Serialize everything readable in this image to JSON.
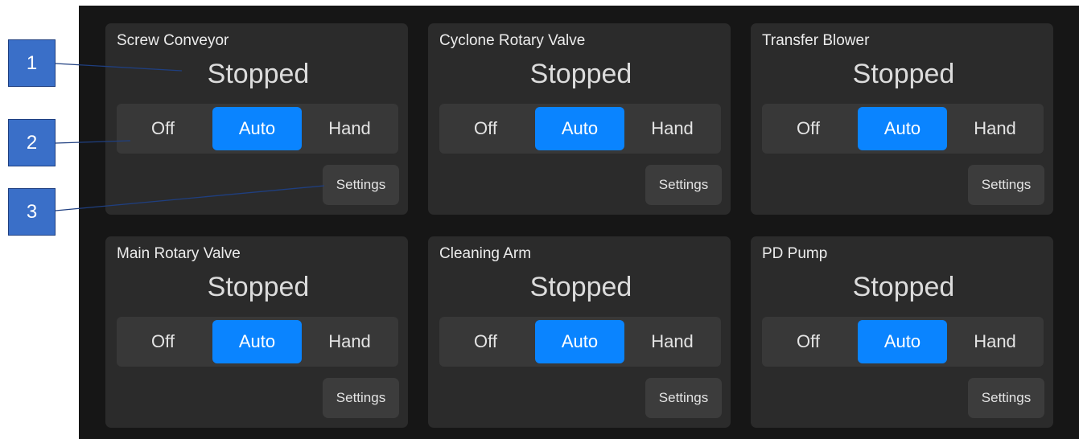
{
  "callouts": [
    "1",
    "2",
    "3"
  ],
  "cards": [
    {
      "title": "Screw Conveyor",
      "status": "Stopped",
      "modes": [
        "Off",
        "Auto",
        "Hand"
      ],
      "active_mode": "Auto",
      "settings_label": "Settings"
    },
    {
      "title": "Cyclone Rotary Valve",
      "status": "Stopped",
      "modes": [
        "Off",
        "Auto",
        "Hand"
      ],
      "active_mode": "Auto",
      "settings_label": "Settings"
    },
    {
      "title": "Transfer Blower",
      "status": "Stopped",
      "modes": [
        "Off",
        "Auto",
        "Hand"
      ],
      "active_mode": "Auto",
      "settings_label": "Settings"
    },
    {
      "title": "Main Rotary Valve",
      "status": "Stopped",
      "modes": [
        "Off",
        "Auto",
        "Hand"
      ],
      "active_mode": "Auto",
      "settings_label": "Settings"
    },
    {
      "title": "Cleaning Arm",
      "status": "Stopped",
      "modes": [
        "Off",
        "Auto",
        "Hand"
      ],
      "active_mode": "Auto",
      "settings_label": "Settings"
    },
    {
      "title": "PD Pump",
      "status": "Stopped",
      "modes": [
        "Off",
        "Auto",
        "Hand"
      ],
      "active_mode": "Auto",
      "settings_label": "Settings"
    }
  ],
  "colors": {
    "panel_bg": "#161616",
    "card_bg": "#2b2b2b",
    "mode_track": "#383838",
    "active_accent": "#0a84ff",
    "settings_bg": "#3c3c3c",
    "callout_bg": "#3a6fc8"
  }
}
